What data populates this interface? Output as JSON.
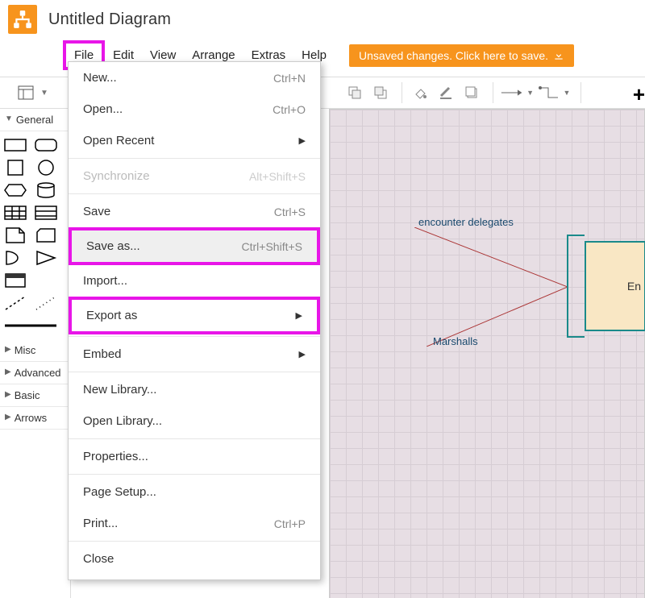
{
  "header": {
    "title": "Untitled Diagram"
  },
  "menubar": {
    "file": "File",
    "edit": "Edit",
    "view": "View",
    "arrange": "Arrange",
    "extras": "Extras",
    "help": "Help",
    "save_banner": "Unsaved changes. Click here to save."
  },
  "sidebar": {
    "general": "General",
    "misc": "Misc",
    "advanced": "Advanced",
    "basic": "Basic",
    "arrows": "Arrows"
  },
  "canvas_labels": {
    "delegates": "encounter delegates",
    "marshalls": "Marshalls",
    "box_partial": "En"
  },
  "file_menu": {
    "new": "New...",
    "new_sc": "Ctrl+N",
    "open": "Open...",
    "open_sc": "Ctrl+O",
    "open_recent": "Open Recent",
    "synchronize": "Synchronize",
    "synchronize_sc": "Alt+Shift+S",
    "save": "Save",
    "save_sc": "Ctrl+S",
    "save_as": "Save as...",
    "save_as_sc": "Ctrl+Shift+S",
    "import": "Import...",
    "export_as": "Export as",
    "embed": "Embed",
    "new_library": "New Library...",
    "open_library": "Open Library...",
    "properties": "Properties...",
    "page_setup": "Page Setup...",
    "print": "Print...",
    "print_sc": "Ctrl+P",
    "close": "Close"
  }
}
